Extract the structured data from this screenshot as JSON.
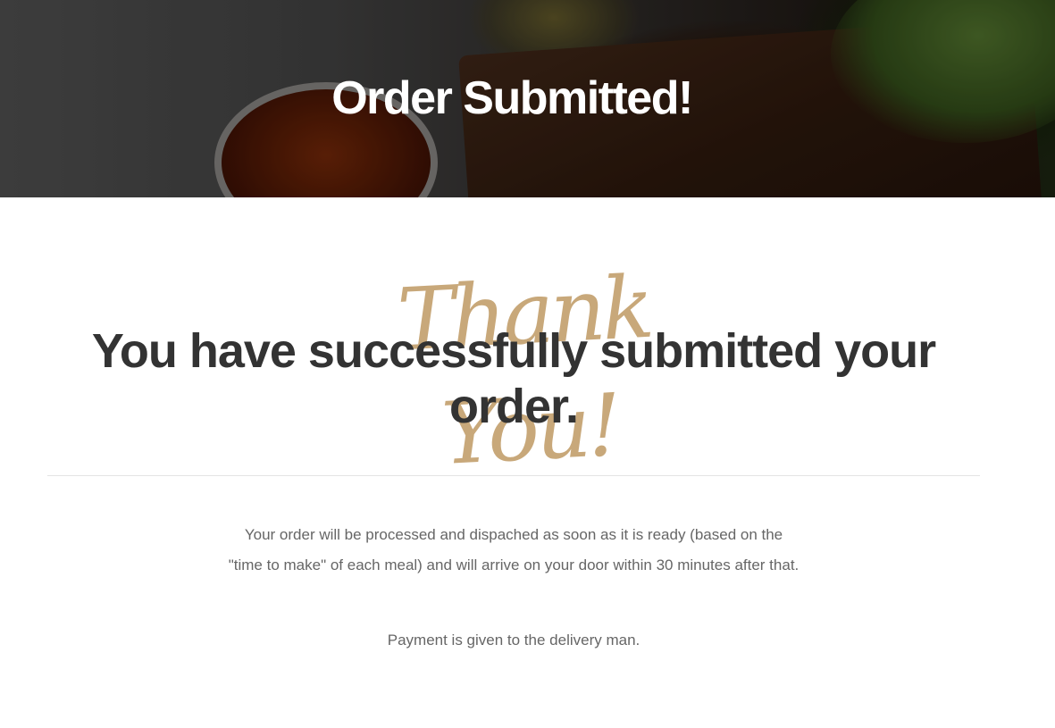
{
  "hero": {
    "title": "Order Submitted!"
  },
  "content": {
    "script_text": "Thank You!",
    "heading": "You have successfully submitted your order.",
    "body": "Your order will be processed and dispached as soon as it is ready (based on the \"time to make\" of each meal) and will arrive on your door within 30 minutes after that.",
    "payment": "Payment is given to the delivery man."
  },
  "colors": {
    "script_accent": "#c8a87a",
    "heading": "#333333",
    "body_text": "#666666"
  }
}
